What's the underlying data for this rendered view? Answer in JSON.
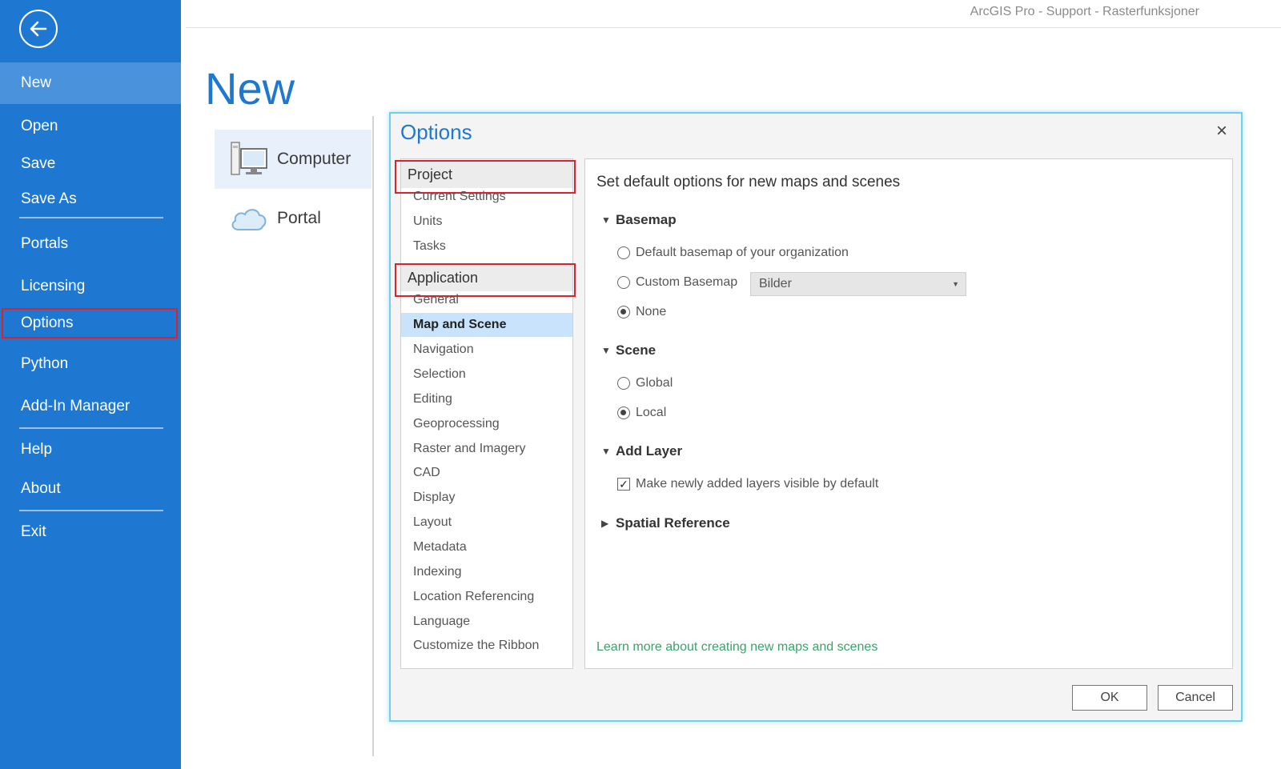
{
  "window": {
    "title": "ArcGIS Pro - Support - Rasterfunksjoner"
  },
  "sidebar": {
    "items": [
      {
        "label": "New"
      },
      {
        "label": "Open"
      },
      {
        "label": "Save"
      },
      {
        "label": "Save As"
      },
      {
        "label": "Portals"
      },
      {
        "label": "Licensing"
      },
      {
        "label": "Options"
      },
      {
        "label": "Python"
      },
      {
        "label": "Add-In Manager"
      },
      {
        "label": "Help"
      },
      {
        "label": "About"
      },
      {
        "label": "Exit"
      }
    ]
  },
  "main": {
    "heading": "New",
    "options": [
      {
        "label": "Computer"
      },
      {
        "label": "Portal"
      }
    ]
  },
  "dialog": {
    "title": "Options",
    "close_label": "×",
    "groups": [
      {
        "label": "Project",
        "items": [
          "Current Settings",
          "Units",
          "Tasks"
        ]
      },
      {
        "label": "Application",
        "items": [
          "General",
          "Map and Scene",
          "Navigation",
          "Selection",
          "Editing",
          "Geoprocessing",
          "Raster and Imagery",
          "CAD",
          "Display",
          "Layout",
          "Metadata",
          "Indexing",
          "Location Referencing",
          "Language",
          "Customize the Ribbon"
        ]
      }
    ],
    "content": {
      "heading": "Set default options for new maps and scenes",
      "basemap": {
        "label": "Basemap",
        "options": [
          "Default basemap of your organization",
          "Custom Basemap",
          "None"
        ],
        "custom_value": "Bilder"
      },
      "scene": {
        "label": "Scene",
        "options": [
          "Global",
          "Local"
        ]
      },
      "add_layer": {
        "label": "Add Layer",
        "checkbox_label": "Make newly added layers visible by default"
      },
      "spatial_reference": {
        "label": "Spatial Reference"
      },
      "learn_more": "Learn more about creating new maps and scenes"
    },
    "buttons": {
      "ok": "OK",
      "cancel": "Cancel"
    }
  },
  "colors": {
    "accent": "#1e78d2",
    "highlight_outline": "#d9232e",
    "link": "#3aa36b",
    "selection": "#c8e3fb"
  }
}
